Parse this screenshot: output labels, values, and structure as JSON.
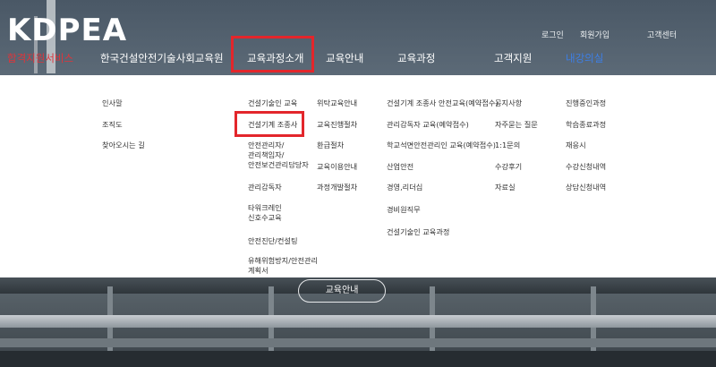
{
  "logo": "KDPEA",
  "util_links": [
    "로그인",
    "회원가입",
    "고객센터"
  ],
  "nav": [
    "합격지원서비스",
    "한국건설안전기술사회교육원",
    "교육과정소개",
    "교육안내",
    "교육과정",
    "고객지원",
    "내강의실"
  ],
  "menu": {
    "col1": [
      "인사말",
      "조직도",
      "찾아오시는 길"
    ],
    "col2": [
      "건설기술인 교육",
      "건설기계 조종사",
      "안전관리자/\n관리책임자/\n안전보건관리담당자",
      "관리감독자",
      "타워크레인\n신호수교육",
      "안전진단/컨설팅",
      "유해위험방지/안전관리\n계획서"
    ],
    "col3": [
      "위탁교육안내",
      "교육진행절차",
      "환급절차",
      "교육이용안내",
      "과정개발절차"
    ],
    "col4": [
      "건설기계 조종사 안전교육(예약접수)",
      "관리감독자 교육(예약접수)",
      "학교석면안전관리인 교육(예약접수)",
      "산업안전",
      "경영,리더십",
      "경비원직무",
      "건설기술인 교육과정"
    ],
    "col5": [
      "공지사항",
      "자주묻는 질문",
      "1:1문의",
      "수강후기",
      "자료실"
    ],
    "col6": [
      "진행중인과정",
      "학습종료과정",
      "재응시",
      "수강신청내역",
      "상담신청내역"
    ]
  },
  "hero_button": "교육안내"
}
